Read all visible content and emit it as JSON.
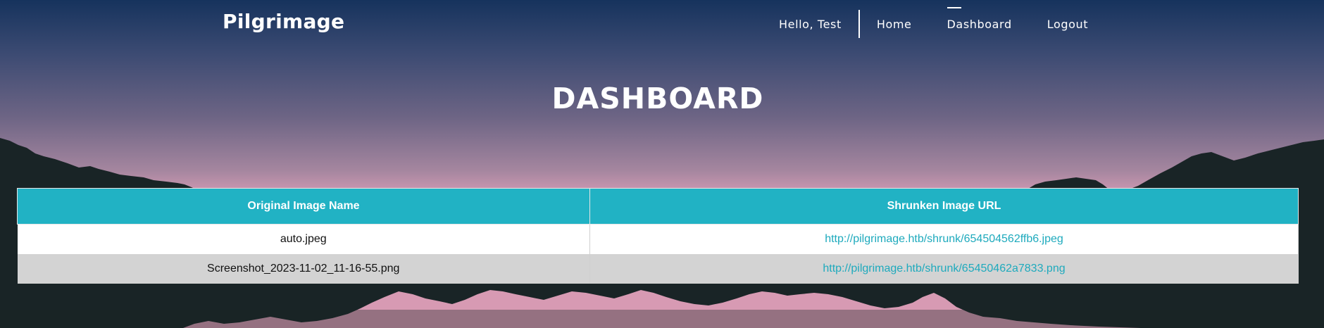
{
  "header": {
    "brand": "Pilgrimage",
    "greeting": "Hello, Test",
    "nav": [
      {
        "label": "Home",
        "active": false
      },
      {
        "label": "Dashboard",
        "active": true
      },
      {
        "label": "Logout",
        "active": false
      }
    ]
  },
  "page_title": "DASHBOARD",
  "table": {
    "columns": [
      "Original Image Name",
      "Shrunken Image URL"
    ],
    "rows": [
      {
        "name": "auto.jpeg",
        "url": "http://pilgrimage.htb/shrunk/654504562ffb6.jpeg"
      },
      {
        "name": "Screenshot_2023-11-02_11-16-55.png",
        "url": "http://pilgrimage.htb/shrunk/65450462a7833.png"
      }
    ]
  },
  "colors": {
    "accent": "#21b2c4",
    "link": "#1eaabd",
    "mountain": "#192426",
    "sky_pink": "#d79ab3",
    "sky_top": "#16335d"
  }
}
